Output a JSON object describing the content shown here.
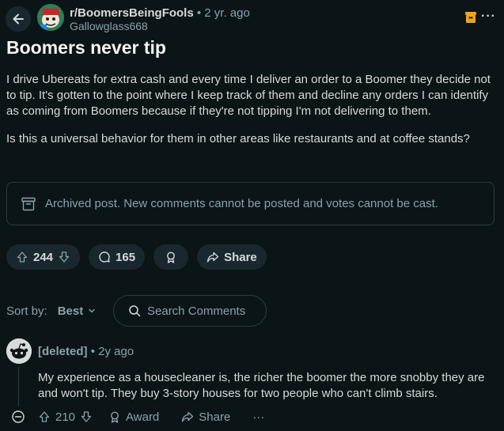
{
  "post": {
    "subreddit": "r/BoomersBeingFools",
    "time": "• 2 yr. ago",
    "author": "Gallowglass668",
    "title": "Boomers never tip",
    "body_p1": "I drive Ubereats for extra cash and every time I deliver an order to a Boomer they decide not to tip. It's gotten to the point where I keep track of them and decline any orders I can identify as coming from Boomers because if they're not tipping I'm not delivering to them.",
    "body_p2": "Is this a universal behavior for them in other areas like restaurants and at coffee stands?",
    "archived_notice": "Archived post. New comments cannot be posted and votes cannot be cast.",
    "votes": "244",
    "comments": "165",
    "share_label": "Share"
  },
  "sort": {
    "label": "Sort by:",
    "value": "Best",
    "search_placeholder": "Search Comments"
  },
  "comment": {
    "author": "[deleted]",
    "time": "• 2y ago",
    "body": "My experience as a housecleaner is, the richer the boomer the more snobby they are and won't tip. They buy 3-story houses for two people who can't climb stairs.",
    "votes": "210",
    "award_label": "Award",
    "share_label": "Share",
    "more_label": "···"
  },
  "colors": {
    "background": "#0b1416",
    "pill": "#1a282d",
    "muted_text": "#8ba2ad"
  }
}
